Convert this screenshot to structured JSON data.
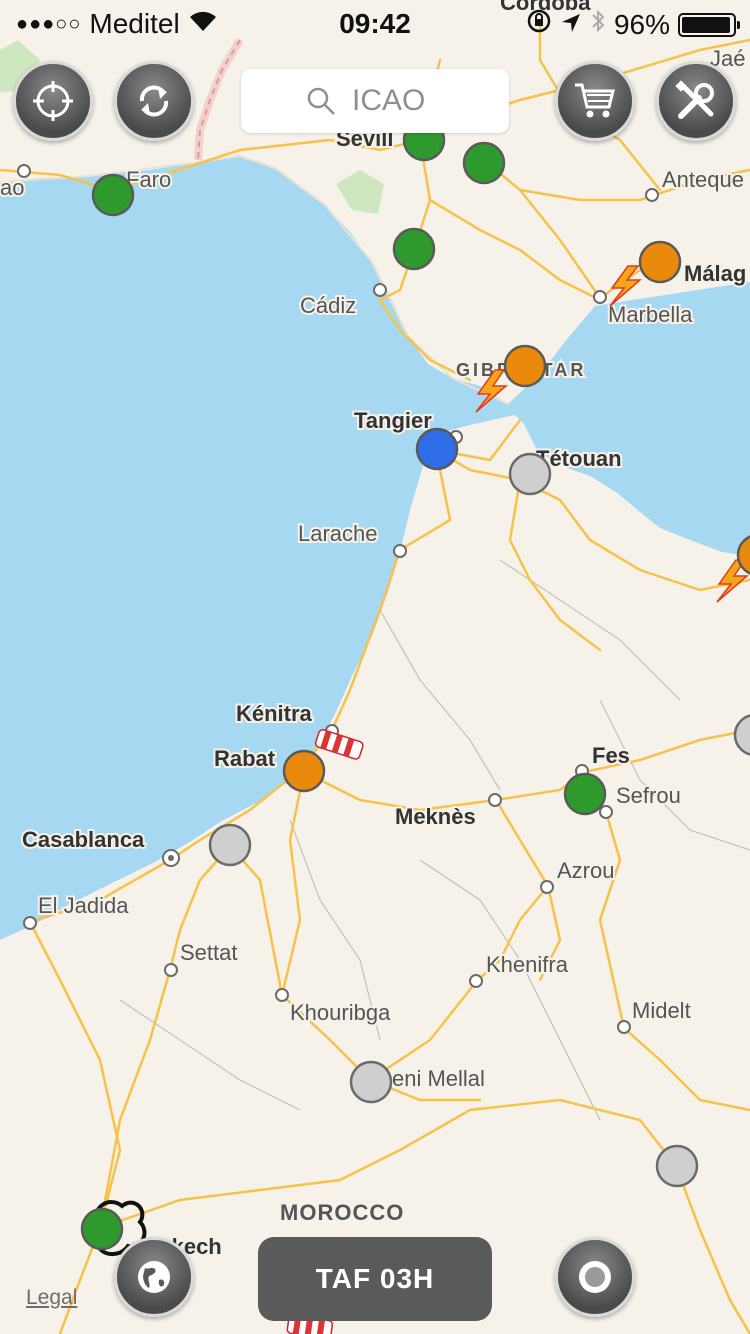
{
  "status_bar": {
    "carrier": "Meditel",
    "signal_dots": "●●●○○",
    "time": "09:42",
    "battery_percent": "96%",
    "battery_level": 0.96
  },
  "toolbar": {
    "search_placeholder": "ICAO",
    "buttons": [
      "locate-icon",
      "refresh-icon",
      "cart-icon",
      "tools-icon"
    ]
  },
  "bottom_bar": {
    "taf_label": "TAF 03H",
    "legal_label": "Legal",
    "buttons": [
      "globe-icon",
      "record-icon"
    ]
  },
  "map": {
    "cities": {
      "cordoba": "Córdoba",
      "jaen": "Jaé",
      "sevilla": "Sevill",
      "faro": "Faro",
      "antequera": "Anteque",
      "cadiz": "Cádiz",
      "malaga": "Málag",
      "marbella": "Marbella",
      "gibraltar": "GIBRALTAR",
      "tangier": "Tangier",
      "tetouan": "Tétouan",
      "larache": "Larache",
      "kenitra": "Kénitra",
      "rabat": "Rabat",
      "fes": "Fes",
      "sefrou": "Sefrou",
      "meknes": "Meknès",
      "casablanca": "Casablanca",
      "azrou": "Azrou",
      "el_jadida": "El Jadida",
      "settat": "Settat",
      "khenifra": "Khenifra",
      "khouribga": "Khouribga",
      "midelt": "Midelt",
      "beni_mellal": "eni Mellal",
      "morocco": "MOROCCO",
      "marrakech": "arrakech",
      "leftedge": "ao"
    },
    "status_colors": {
      "vfr": "#2e9a2e",
      "mvfr": "#2f6ee8",
      "ifr": "#ea8a0c",
      "unknown": "#c8c8c8"
    },
    "water_color": "#a6d8f2",
    "land_color": "#f6f2ea",
    "road_color": "#f7c24a"
  }
}
